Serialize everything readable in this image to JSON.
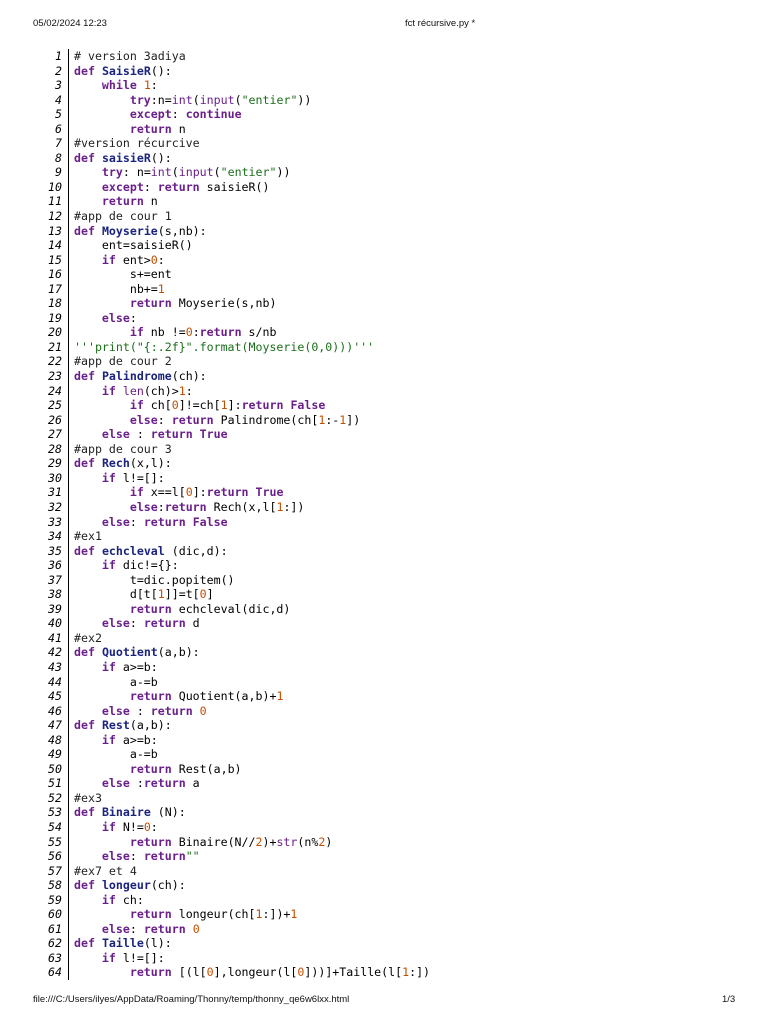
{
  "header": {
    "datetime": "05/02/2024 12:23",
    "title": "fct récursive.py *"
  },
  "footer": {
    "path": "file:///C:/Users/ilyes/AppData/Roaming/Thonny/temp/thonny_qe6w6lxx.html",
    "page": "1/3"
  },
  "code_lines": [
    "# version 3adiya",
    "def SaisieR():",
    "    while 1:",
    "        try:n=int(input(\"entier\"))",
    "        except: continue",
    "        return n",
    "#version récurcive",
    "def saisieR():",
    "    try: n=int(input(\"entier\"))",
    "    except: return saisieR()",
    "    return n",
    "#app de cour 1",
    "def Moyserie(s,nb):",
    "    ent=saisieR()",
    "    if ent>0:",
    "        s+=ent",
    "        nb+=1",
    "        return Moyserie(s,nb)",
    "    else:",
    "        if nb !=0:return s/nb",
    "'''print(\"{:.2f}\".format(Moyserie(0,0)))'''",
    "#app de cour 2",
    "def Palindrome(ch):",
    "    if len(ch)>1:",
    "        if ch[0]!=ch[1]:return False",
    "        else: return Palindrome(ch[1:-1])",
    "    else : return True",
    "#app de cour 3",
    "def Rech(x,l):",
    "    if l!=[]:",
    "        if x==l[0]:return True",
    "        else:return Rech(x,l[1:])",
    "    else: return False",
    "#ex1",
    "def echcleval (dic,d):",
    "    if dic!={}:",
    "        t=dic.popitem()",
    "        d[t[1]]=t[0]",
    "        return echcleval(dic,d)",
    "    else: return d",
    "#ex2",
    "def Quotient(a,b):",
    "    if a>=b:",
    "        a-=b",
    "        return Quotient(a,b)+1",
    "    else : return 0",
    "def Rest(a,b):",
    "    if a>=b:",
    "        a-=b",
    "        return Rest(a,b)",
    "    else :return a",
    "#ex3",
    "def Binaire (N):",
    "    if N!=0:",
    "        return Binaire(N//2)+str(n%2)",
    "    else: return\"\"",
    "#ex7 et 4",
    "def longeur(ch):",
    "    if ch:",
    "        return longeur(ch[1:])+1",
    "    else: return 0",
    "def Taille(l):",
    "    if l!=[]:",
    "        return [(l[0],longeur(l[0]))]+Taille(l[1:])"
  ]
}
